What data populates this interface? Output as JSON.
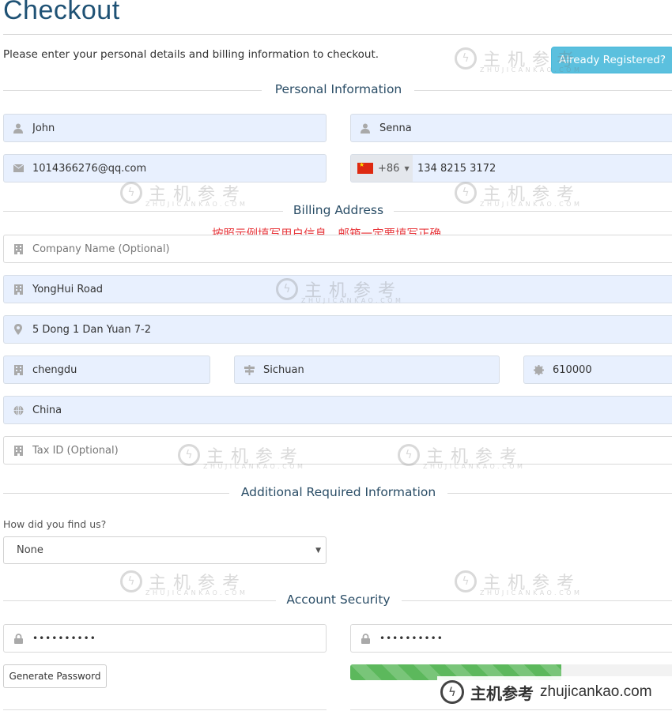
{
  "page": {
    "title": "Checkout",
    "intro": "Please enter your personal details and billing information to checkout.",
    "already_registered_label": "Already Registered?"
  },
  "sections": {
    "personal": "Personal Information",
    "billing": "Billing Address",
    "additional": "Additional Required Information",
    "security": "Account Security"
  },
  "personal": {
    "first_name": {
      "value": "John",
      "icon": "user-icon"
    },
    "last_name": {
      "value": "Senna",
      "icon": "user-icon"
    },
    "email": {
      "value": "1014366276@qq.com",
      "icon": "envelope-icon"
    },
    "phone": {
      "country_code": "+86",
      "country": "China",
      "value": "134 8215 3172"
    }
  },
  "annotation": "按照示例填写用户信息，邮箱一定要填写正确",
  "billing": {
    "company": {
      "value": "",
      "placeholder": "Company Name (Optional)",
      "icon": "building-icon"
    },
    "address1": {
      "value": "YongHui Road",
      "icon": "building-icon"
    },
    "address2": {
      "value": "5 Dong 1 Dan Yuan 7-2",
      "icon": "map-marker-icon"
    },
    "city": {
      "value": "chengdu",
      "icon": "building-icon"
    },
    "state": {
      "value": "Sichuan",
      "icon": "signpost-icon"
    },
    "postcode": {
      "value": "610000",
      "icon": "certificate-icon"
    },
    "country": {
      "value": "China",
      "icon": "globe-icon"
    },
    "tax_id": {
      "value": "",
      "placeholder": "Tax ID (Optional)",
      "icon": "building-icon"
    }
  },
  "additional": {
    "question": "How did you find us?",
    "selected": "None"
  },
  "security": {
    "password": "••••••••••",
    "password_confirm": "••••••••••",
    "generate_label": "Generate Password",
    "strength_percent": 65,
    "strength_color": "#5cb85c"
  },
  "watermark": {
    "cn": "主机参考",
    "en": "ZHUJICANKAO.COM",
    "brand_en": "zhujicankao.com"
  }
}
